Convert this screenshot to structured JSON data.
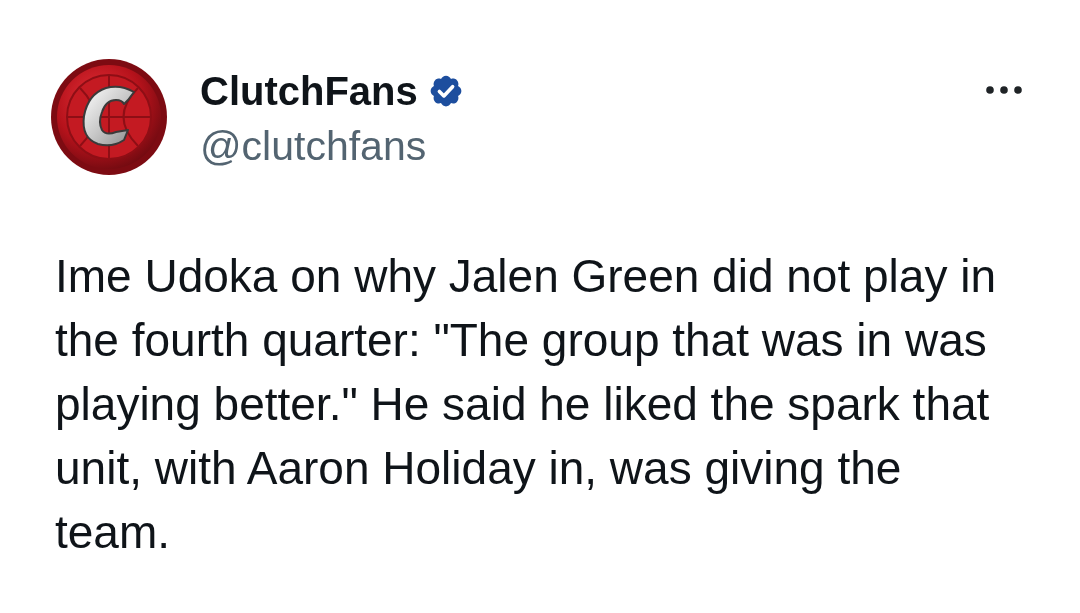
{
  "post": {
    "author": {
      "name": "ClutchFans",
      "verified": true,
      "handle": "@clutchfans"
    },
    "text": "Ime Udoka on why Jalen Green did not play in the fourth quarter: \"The group that was in was playing better.\" He said he liked the spark that unit, with Aaron Holiday in, was giving the team."
  }
}
